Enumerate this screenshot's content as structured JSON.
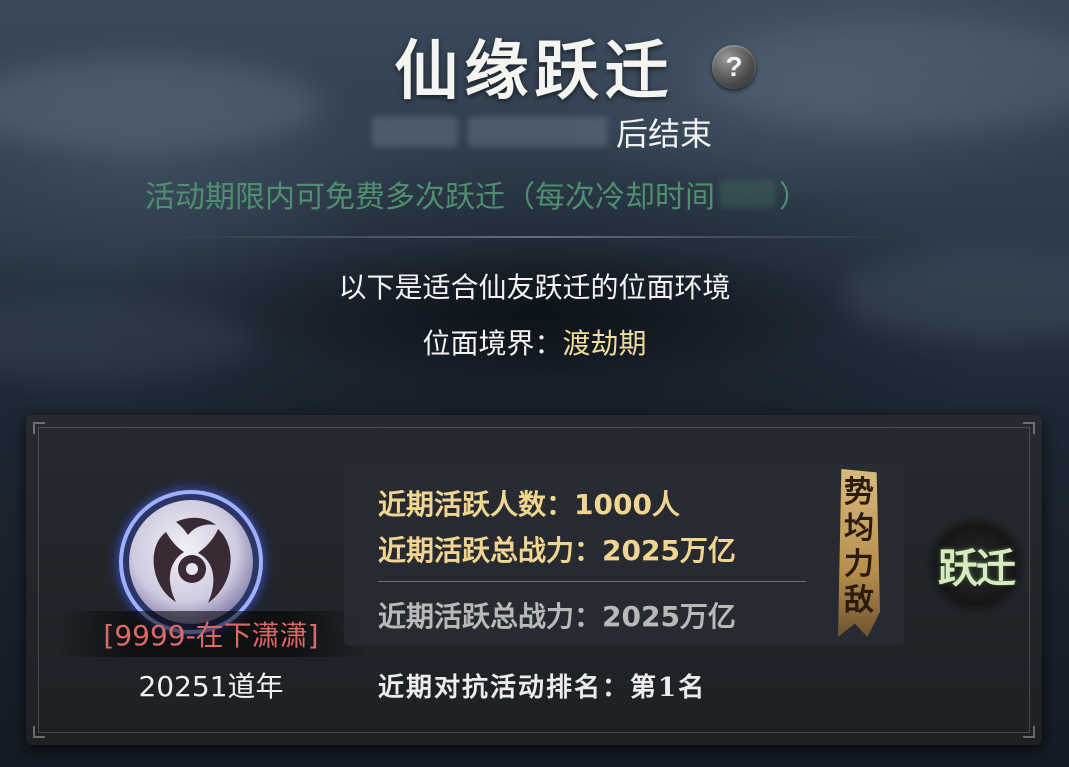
{
  "header": {
    "title": "仙缘跃迁",
    "help_symbol": "?",
    "countdown_suffix": "后结束",
    "hint_prefix": "活动期限内可免费多次跃迁（每次冷却时间",
    "hint_suffix": "）"
  },
  "info": {
    "line1": "以下是适合仙友跃迁的位面环境",
    "realm_label": "位面境界：",
    "realm_value": "渡劫期"
  },
  "card": {
    "server_name": "[9999-在下潇潇]",
    "year": "20251道年",
    "stats": {
      "active_players": "近期活跃人数：1000人",
      "active_power": "近期活跃总战力：2025万亿",
      "compare_power": "近期活跃总战力：2025万亿"
    },
    "banner_text": [
      "势",
      "均",
      "力",
      "敌"
    ],
    "jump_button_label": "跃迁",
    "rank_text": "近期对抗活动排名：第1名"
  },
  "colors": {
    "gold": "#f1d691",
    "green_hint": "#4f8f6f",
    "server_red": "#d96a66",
    "realm_gold": "#f1dc9a"
  },
  "icons": {
    "help": "help-icon",
    "emblem": "server-emblem-icon",
    "jump": "jump-button-icon"
  }
}
